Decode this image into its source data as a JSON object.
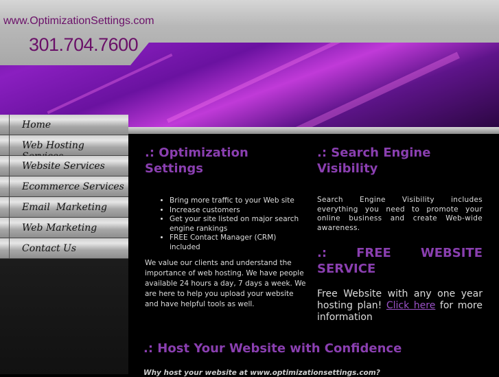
{
  "header": {
    "url": "www.OptimizationSettings.com",
    "phone": "301.704.7600"
  },
  "nav": [
    {
      "label": "Home"
    },
    {
      "label": "Web Hosting Services"
    },
    {
      "label": "Website Services"
    },
    {
      "label": "Ecommerce Services"
    },
    {
      "label": "Email  Marketing"
    },
    {
      "label": "Web Marketing"
    },
    {
      "label": "Contact Us"
    }
  ],
  "optimization": {
    "title": ".: Optimization Settings",
    "bullets": [
      "Bring more traffic to your Web site",
      "Increase customers",
      "Get your site listed on major search engine rankings",
      "FREE Contact Manager (CRM) included"
    ],
    "body": "We value our clients and understand the importance of web hosting. We have people available 24 hours a day, 7 days a week. We are here to help you upload your website and have helpful tools as well."
  },
  "visibility": {
    "title": ".: Search Engine Visibility",
    "body": "Search Engine Visibility includes everything you need to promote your online business and create Web-wide awareness."
  },
  "free": {
    "title": ".: FREE WEBSITE SERVICE",
    "text_before": "Free Website with any one year hosting plan! ",
    "link": "Click here",
    "text_after": " for more information"
  },
  "host": {
    "title": ".: Host Your Website with Confidence",
    "question": "Why host your website at www.optimizationsettings.com?"
  },
  "colors": {
    "accent": "#8a3fb0",
    "brand": "#6a1068"
  }
}
